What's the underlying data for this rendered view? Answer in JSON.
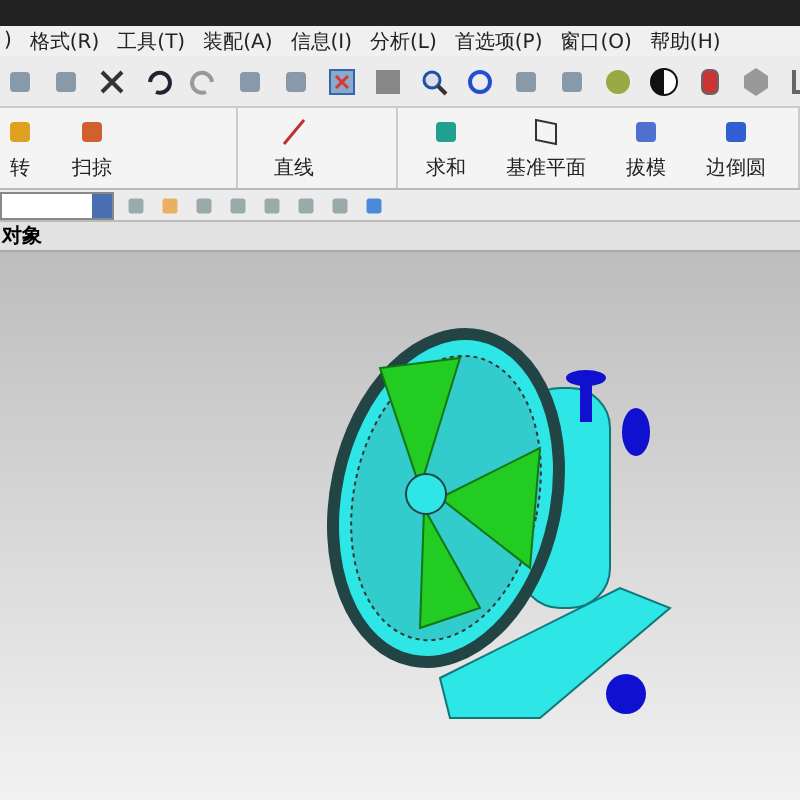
{
  "menu_bar": {
    "items": [
      ")",
      "格式(R)",
      "工具(T)",
      "装配(A)",
      "信息(I)",
      "分析(L)",
      "首选项(P)",
      "窗口(O)",
      "帮助(H)"
    ]
  },
  "ribbon": {
    "groups": [
      {
        "items": [
          {
            "label": "转",
            "kind": "feature"
          },
          {
            "label": "扫掠",
            "kind": "sweep"
          }
        ]
      },
      {
        "items": [
          {
            "label": "直线",
            "kind": "line"
          }
        ]
      },
      {
        "items": [
          {
            "label": "求和",
            "kind": "unite"
          },
          {
            "label": "基准平面",
            "kind": "plane"
          },
          {
            "label": "拔模",
            "kind": "draft"
          },
          {
            "label": "边倒圆",
            "kind": "blend"
          }
        ]
      }
    ]
  },
  "panel": {
    "title": "对象"
  }
}
